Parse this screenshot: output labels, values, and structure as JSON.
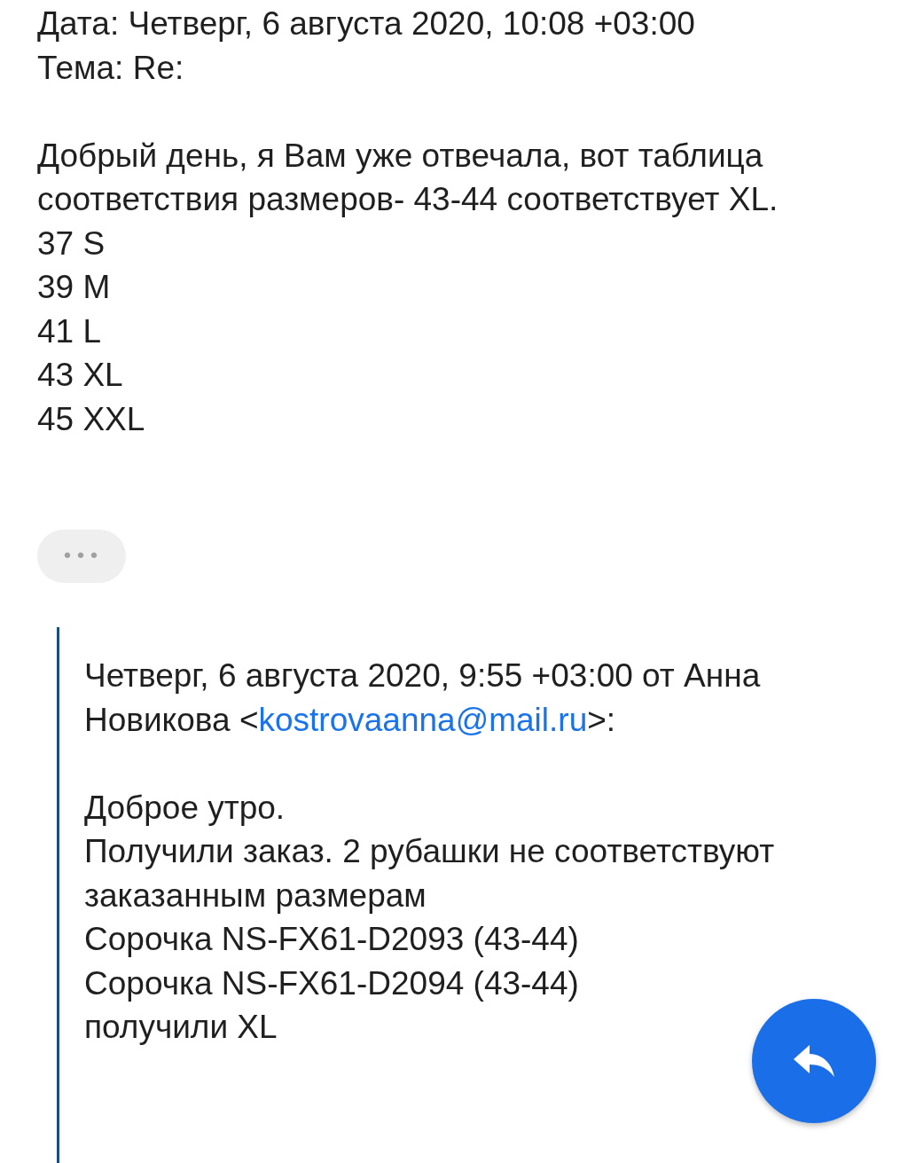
{
  "header_lines": [
    "Дата: Четверг, 6 августа 2020, 10:08 +03:00",
    "Тема: Re:"
  ],
  "message": {
    "paragraph": "Добрый день, я Вам уже отвечала, вот таблица соответствия размеров- 43-44 соответствует XL.",
    "lines": [
      "37 S",
      "39 M",
      "41 L",
      "43 XL",
      "45 XXL"
    ]
  },
  "more_button": {
    "label": "•••"
  },
  "quote": {
    "attribution_before": "Четверг, 6 августа 2020, 9:55 +03:00 от Анна Новикова <",
    "email": "kostrovaanna@mail.ru",
    "attribution_after": ">:",
    "lines": [
      "Доброе утро.",
      "Получили заказ. 2 рубашки не соответствуют заказанным размерам",
      "Сорочка NS-FX61-D2093 (43-44)",
      "Сорочка NS-FX61-D2094 (43-44)",
      "получили XL"
    ]
  }
}
